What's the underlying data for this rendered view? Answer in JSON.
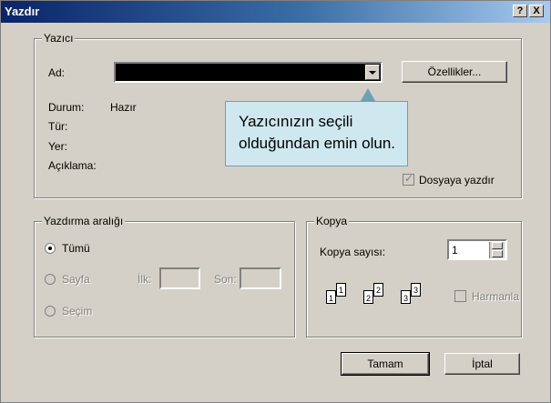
{
  "window": {
    "title": "Yazdır",
    "help_label": "?",
    "close_label": "X"
  },
  "printer": {
    "legend": "Yazıcı",
    "name_label": "Ad:",
    "name_value": "",
    "properties_label": "Özellikler...",
    "status_label": "Durum:",
    "status_value": "Hazır",
    "type_label": "Tür:",
    "where_label": "Yer:",
    "comment_label": "Açıklama:",
    "print_to_file_label": "Dosyaya yazdır",
    "print_to_file_checked": true
  },
  "callout": {
    "line1": "Yazıcınızın seçili",
    "line2": "olduğundan emin olun."
  },
  "range": {
    "legend": "Yazdırma aralığı",
    "all_label": "Tümü",
    "pages_label": "Sayfa",
    "from_label": "İlk:",
    "to_label": "Son:",
    "selection_label": "Seçim",
    "selected": "Tümü"
  },
  "copies": {
    "legend": "Kopya",
    "count_label": "Kopya sayısı:",
    "count_value": "1",
    "collate_label": "Harmanla",
    "collate_checked": false,
    "page_icons": [
      "1",
      "1",
      "2",
      "2",
      "3",
      "3"
    ]
  },
  "buttons": {
    "ok_label": "Tamam",
    "cancel_label": "İptal"
  },
  "colors": {
    "dialog_bg": "#d4d0c8",
    "title_bar": "#0a246a",
    "callout_bg": "#cfe8ef"
  }
}
